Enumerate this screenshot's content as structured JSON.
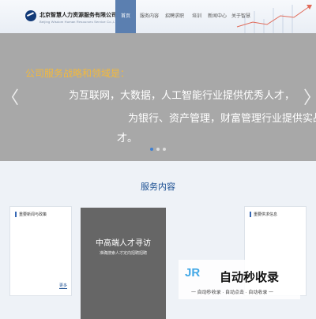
{
  "header": {
    "company_name": "北京智慧人力资源服务有限公司",
    "company_tagline": "Beijing Wisdom Human Resources Service Co.,LTD",
    "nav": [
      {
        "label": "首页",
        "active": true
      },
      {
        "label": "服务内容",
        "active": false
      },
      {
        "label": "招聘求职",
        "active": false
      },
      {
        "label": "培训",
        "active": false
      },
      {
        "label": "新闻中心",
        "active": false
      },
      {
        "label": "关于智慧",
        "active": false
      }
    ]
  },
  "hero": {
    "line1": "公司服务战略和领域是：",
    "line2": "为互联网，大数据，人工智能行业提供优秀人才，",
    "line3": "为银行、资产管理，财富管理行业提供实战人",
    "line4": "才。",
    "arrow_prev": "〈",
    "arrow_next": "〉",
    "slides": 3,
    "active_slide": 1
  },
  "services": {
    "title": "服务内容",
    "card_left_title": "重要新闻与政策",
    "card_left_more": "更多",
    "feature_title": "中高端人才寻访",
    "feature_subtitle": "准确搜索人才定向招聘招聘",
    "card_right_title": "重要供求信息"
  },
  "watermark": {
    "logo": "JR",
    "text": "自动秒收录",
    "sub": "一 自动秒收录 · 自动点击 · 自动收录 一"
  },
  "colors": {
    "nav_active": "#5b7fb0",
    "brand_blue": "#1b4f92",
    "hero_accent": "#f3b93b"
  }
}
